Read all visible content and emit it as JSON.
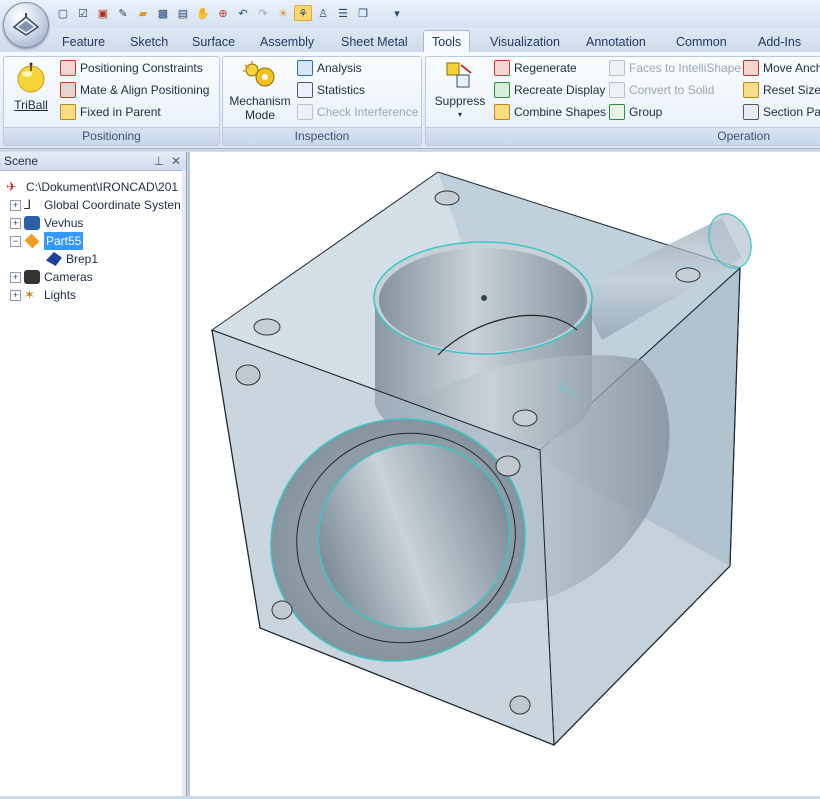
{
  "qat": {
    "icons": [
      "new-icon",
      "open-check-icon",
      "close-doc-icon",
      "edit-icon",
      "folder-icon",
      "save-icon",
      "save-as-icon",
      "hand-icon",
      "zoom-icon",
      "undo-icon",
      "redo-icon",
      "bulb-icon",
      "tree-icon",
      "person-icon",
      "list-icon",
      "copy-icon",
      "dropdown-icon"
    ]
  },
  "tabs": [
    "Feature",
    "Sketch",
    "Surface",
    "Assembly",
    "Sheet Metal",
    "Tools",
    "Visualization",
    "Annotation",
    "Common",
    "Add-Ins"
  ],
  "active_tab": "Tools",
  "ribbon": {
    "positioning": {
      "label": "Positioning",
      "triball": "TriBall",
      "items": [
        "Positioning Constraints",
        "Mate & Align Positioning",
        "Fixed in Parent"
      ]
    },
    "inspection": {
      "label": "Inspection",
      "mechanism": "Mechanism Mode",
      "items": [
        "Analysis",
        "Statistics",
        "Check Interference"
      ]
    },
    "operations": {
      "label": "Operation",
      "suppress": "Suppress",
      "col1": [
        "Regenerate",
        "Recreate Display",
        "Combine Shapes"
      ],
      "col2": [
        "Faces to IntelliShape",
        "Convert to Solid",
        "Group"
      ],
      "col3": [
        "Move Anch",
        "Reset Sizeb",
        "Section Par"
      ]
    }
  },
  "scene": {
    "title": "Scene",
    "tree": [
      {
        "label": "C:\\Dokument\\IRONCAD\\201",
        "level": 0,
        "icon": "scene-root-icon"
      },
      {
        "label": "Global Coordinate Systen",
        "level": 1,
        "icon": "axes-icon"
      },
      {
        "label": "Vevhus",
        "level": 1,
        "icon": "assembly-icon"
      },
      {
        "label": "Part55",
        "level": 1,
        "icon": "part-icon",
        "selected": true
      },
      {
        "label": "Brep1",
        "level": 2,
        "icon": "brep-icon"
      },
      {
        "label": "Cameras",
        "level": 1,
        "icon": "camera-icon"
      },
      {
        "label": "Lights",
        "level": 1,
        "icon": "light-icon"
      }
    ]
  },
  "colors": {
    "accent": "#3399ff",
    "ribbon": "#dde7f3",
    "edge": "#39c6c6",
    "body": "#9fb0bd"
  }
}
